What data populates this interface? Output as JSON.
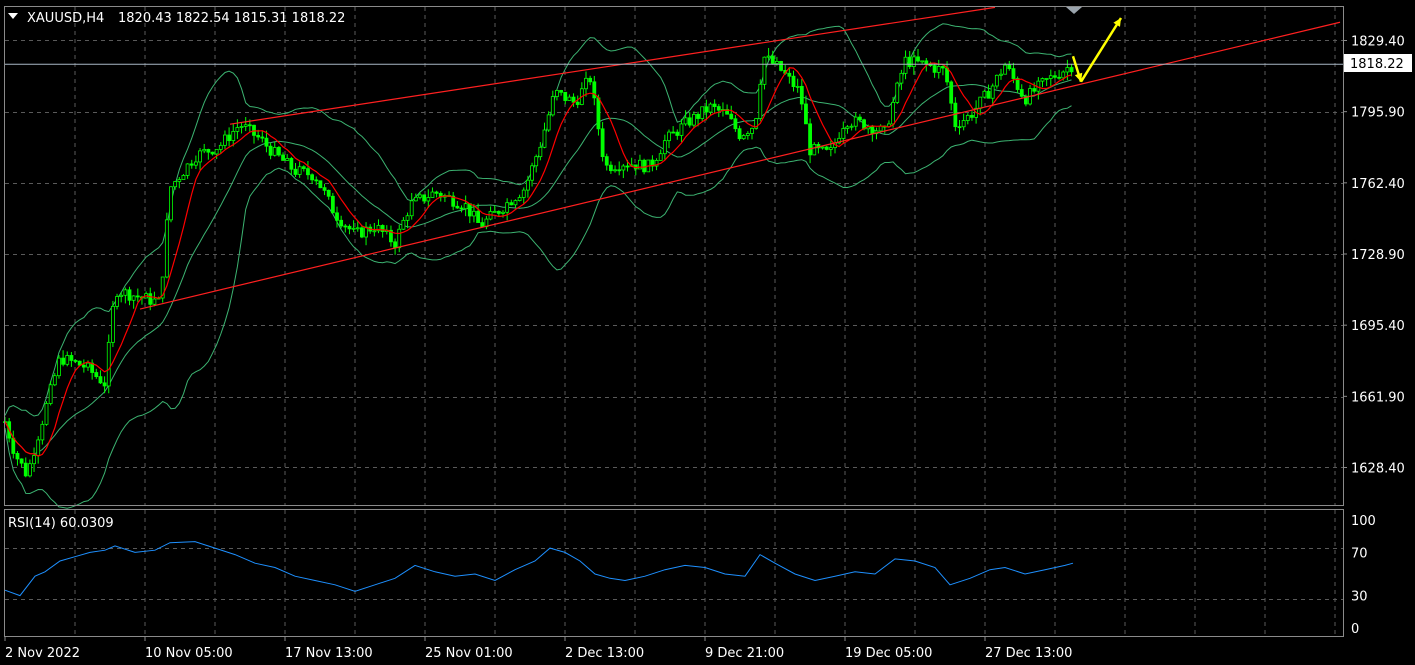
{
  "header": {
    "symbol": "XAUUSD,H4",
    "ohlc": "1820.43 1822.54 1815.31 1818.22"
  },
  "rsi_header": "RSI(14) 60.0309",
  "colors": {
    "background": "#000000",
    "grid": "#5a5a5a",
    "bull_candle": "#00ff00",
    "bear_candle": "#00ff00",
    "ma": "#ff0000",
    "bands": "#3cb371",
    "channel": "#ff2020",
    "rsi": "#1e90ff",
    "arrow": "#ffff00",
    "current_price_line": "#a9b7c6"
  },
  "chart_data": [
    {
      "type": "candlestick",
      "symbol": "XAUUSD",
      "timeframe": "H4",
      "current_price": "1818.22",
      "price_ticks": [
        "1829.40",
        "1795.90",
        "1762.40",
        "1728.90",
        "1695.40",
        "1661.90",
        "1628.40"
      ],
      "x_ticks": [
        "2 Nov 2022",
        "10 Nov 05:00",
        "17 Nov 13:00",
        "25 Nov 01:00",
        "2 Dec 13:00",
        "9 Dec 21:00",
        "19 Dec 05:00",
        "27 Dec 13:00"
      ],
      "ylim": [
        1610,
        1845
      ],
      "close_path": [
        [
          0,
          1650
        ],
        [
          10,
          1635
        ],
        [
          22,
          1625
        ],
        [
          40,
          1655
        ],
        [
          55,
          1680
        ],
        [
          80,
          1676
        ],
        [
          100,
          1668
        ],
        [
          110,
          1712
        ],
        [
          140,
          1708
        ],
        [
          155,
          1706
        ],
        [
          165,
          1760
        ],
        [
          190,
          1775
        ],
        [
          215,
          1780
        ],
        [
          235,
          1790
        ],
        [
          255,
          1783
        ],
        [
          270,
          1776
        ],
        [
          290,
          1768
        ],
        [
          310,
          1766
        ],
        [
          330,
          1748
        ],
        [
          350,
          1738
        ],
        [
          370,
          1742
        ],
        [
          390,
          1734
        ],
        [
          405,
          1752
        ],
        [
          430,
          1758
        ],
        [
          460,
          1752
        ],
        [
          475,
          1742
        ],
        [
          500,
          1752
        ],
        [
          520,
          1760
        ],
        [
          535,
          1780
        ],
        [
          550,
          1805
        ],
        [
          570,
          1800
        ],
        [
          585,
          1812
        ],
        [
          600,
          1770
        ],
        [
          620,
          1772
        ],
        [
          645,
          1770
        ],
        [
          660,
          1782
        ],
        [
          680,
          1790
        ],
        [
          705,
          1798
        ],
        [
          720,
          1795
        ],
        [
          735,
          1785
        ],
        [
          750,
          1790
        ],
        [
          758,
          1822
        ],
        [
          775,
          1816
        ],
        [
          795,
          1805
        ],
        [
          805,
          1778
        ],
        [
          825,
          1776
        ],
        [
          840,
          1792
        ],
        [
          860,
          1790
        ],
        [
          880,
          1786
        ],
        [
          900,
          1820
        ],
        [
          920,
          1818
        ],
        [
          940,
          1815
        ],
        [
          950,
          1790
        ],
        [
          965,
          1794
        ],
        [
          985,
          1806
        ],
        [
          1000,
          1818
        ],
        [
          1020,
          1802
        ],
        [
          1040,
          1810
        ],
        [
          1060,
          1816
        ],
        [
          1068,
          1818
        ]
      ],
      "channel_upper": [
        [
          230,
          1790
        ],
        [
          995,
          1845
        ]
      ],
      "channel_lower": [
        [
          140,
          1703
        ],
        [
          1340,
          1838
        ]
      ],
      "arrows": [
        {
          "from": [
            1068,
            1822
          ],
          "to": [
            1076,
            1810
          ]
        },
        {
          "from": [
            1076,
            1810
          ],
          "to": [
            1116,
            1840
          ]
        }
      ]
    },
    {
      "type": "line",
      "indicator": "RSI(14)",
      "value": "60.0309",
      "y_ticks": [
        "100",
        "70",
        "30",
        "0"
      ],
      "ylim": [
        0,
        100
      ],
      "path": [
        [
          0,
          35
        ],
        [
          15,
          30
        ],
        [
          30,
          48
        ],
        [
          40,
          52
        ],
        [
          55,
          62
        ],
        [
          70,
          66
        ],
        [
          85,
          70
        ],
        [
          100,
          72
        ],
        [
          110,
          76
        ],
        [
          130,
          70
        ],
        [
          150,
          72
        ],
        [
          165,
          79
        ],
        [
          190,
          80
        ],
        [
          210,
          74
        ],
        [
          230,
          68
        ],
        [
          250,
          60
        ],
        [
          270,
          56
        ],
        [
          290,
          48
        ],
        [
          310,
          44
        ],
        [
          330,
          40
        ],
        [
          350,
          34
        ],
        [
          370,
          40
        ],
        [
          390,
          46
        ],
        [
          410,
          58
        ],
        [
          430,
          52
        ],
        [
          450,
          48
        ],
        [
          470,
          50
        ],
        [
          490,
          44
        ],
        [
          510,
          54
        ],
        [
          530,
          62
        ],
        [
          545,
          74
        ],
        [
          560,
          70
        ],
        [
          575,
          62
        ],
        [
          590,
          50
        ],
        [
          605,
          46
        ],
        [
          620,
          44
        ],
        [
          640,
          48
        ],
        [
          660,
          54
        ],
        [
          680,
          58
        ],
        [
          700,
          56
        ],
        [
          720,
          50
        ],
        [
          740,
          48
        ],
        [
          755,
          68
        ],
        [
          770,
          60
        ],
        [
          790,
          50
        ],
        [
          810,
          44
        ],
        [
          830,
          48
        ],
        [
          850,
          52
        ],
        [
          870,
          50
        ],
        [
          890,
          64
        ],
        [
          910,
          62
        ],
        [
          930,
          56
        ],
        [
          945,
          40
        ],
        [
          965,
          46
        ],
        [
          985,
          54
        ],
        [
          1000,
          56
        ],
        [
          1020,
          50
        ],
        [
          1040,
          54
        ],
        [
          1060,
          58
        ],
        [
          1068,
          60
        ]
      ]
    }
  ]
}
